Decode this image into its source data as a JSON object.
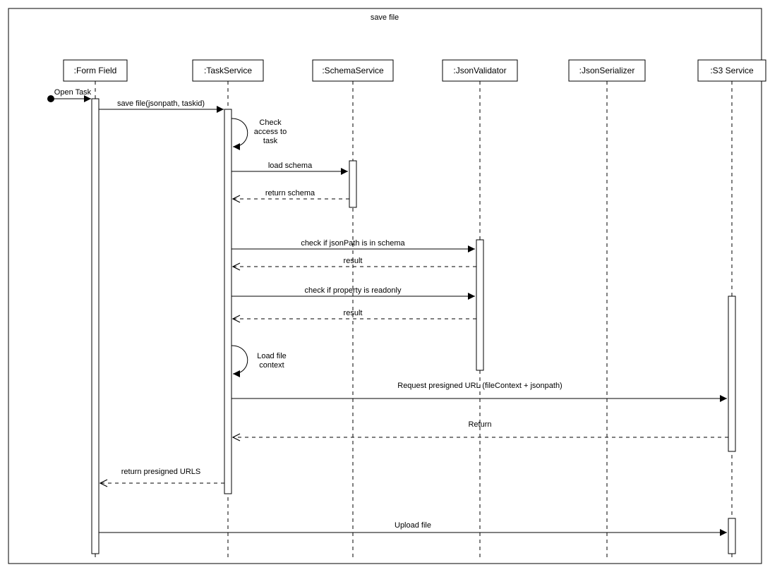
{
  "title": "save file",
  "participants": {
    "formField": ":Form Field",
    "taskService": ":TaskService",
    "schemaService": ":SchemaService",
    "jsonValidator": ":JsonValidator",
    "jsonSerializer": ":JsonSerializer",
    "s3Service": ":S3 Service"
  },
  "startMessage": "Open Task",
  "messages": {
    "saveFile": "save file(jsonpath, taskid)",
    "checkAccess1": "Check",
    "checkAccess2": "access to",
    "checkAccess3": "task",
    "loadSchema": "load schema",
    "returnSchema": "return schema",
    "checkPath": "check if jsonPath is in schema",
    "result1": "result",
    "checkReadonly": "check if property is readonly",
    "result2": "result",
    "loadFile1": "Load file",
    "loadFile2": "context",
    "requestUrl": "Request presigned URL (fileContext + jsonpath)",
    "return": "Return",
    "returnUrls": "return presigned URLS",
    "uploadFile": "Upload file"
  }
}
